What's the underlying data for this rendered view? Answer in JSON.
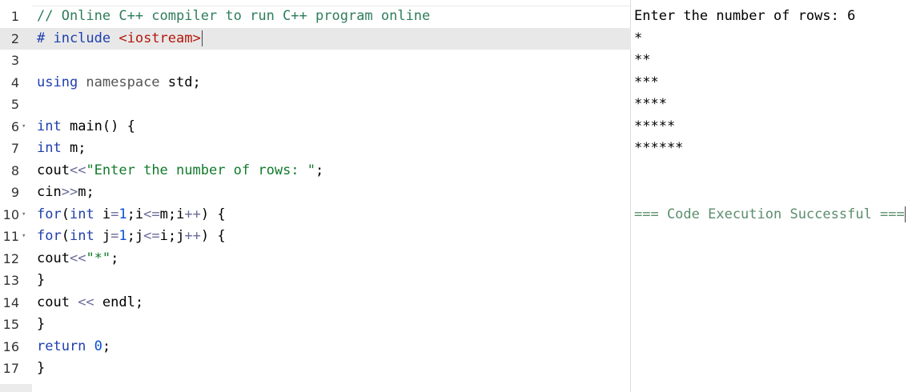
{
  "editor": {
    "lines": [
      {
        "n": "1",
        "parts": [
          {
            "t": "// Online C++ compiler to run C++ program online",
            "c": "cmt"
          }
        ]
      },
      {
        "n": "2",
        "active": true,
        "parts": [
          {
            "t": "# include ",
            "c": "kw"
          },
          {
            "t": "<iostream>",
            "c": "inc"
          }
        ]
      },
      {
        "n": "3",
        "parts": []
      },
      {
        "n": "4",
        "parts": [
          {
            "t": "using ",
            "c": "kw"
          },
          {
            "t": "namespace ",
            "c": "ns"
          },
          {
            "t": "std;",
            "c": ""
          }
        ]
      },
      {
        "n": "5",
        "parts": []
      },
      {
        "n": "6",
        "fold": true,
        "parts": [
          {
            "t": "int ",
            "c": "kw"
          },
          {
            "t": "main() {",
            "c": ""
          }
        ]
      },
      {
        "n": "7",
        "parts": [
          {
            "t": "int ",
            "c": "kw"
          },
          {
            "t": "m;",
            "c": ""
          }
        ]
      },
      {
        "n": "8",
        "parts": [
          {
            "t": "cout",
            "c": ""
          },
          {
            "t": "<<",
            "c": "op"
          },
          {
            "t": "\"Enter the number of rows: \"",
            "c": "str"
          },
          {
            "t": ";",
            "c": ""
          }
        ]
      },
      {
        "n": "9",
        "parts": [
          {
            "t": "cin",
            "c": ""
          },
          {
            "t": ">>",
            "c": "op"
          },
          {
            "t": "m;",
            "c": ""
          }
        ]
      },
      {
        "n": "10",
        "fold": true,
        "parts": [
          {
            "t": "for",
            "c": "kw"
          },
          {
            "t": "(",
            "c": ""
          },
          {
            "t": "int ",
            "c": "kw"
          },
          {
            "t": "i",
            "c": ""
          },
          {
            "t": "=",
            "c": "op"
          },
          {
            "t": "1",
            "c": "num"
          },
          {
            "t": ";i",
            "c": ""
          },
          {
            "t": "<=",
            "c": "op"
          },
          {
            "t": "m;i",
            "c": ""
          },
          {
            "t": "++",
            "c": "op"
          },
          {
            "t": ") {",
            "c": ""
          }
        ]
      },
      {
        "n": "11",
        "fold": true,
        "parts": [
          {
            "t": "for",
            "c": "kw"
          },
          {
            "t": "(",
            "c": ""
          },
          {
            "t": "int ",
            "c": "kw"
          },
          {
            "t": "j",
            "c": ""
          },
          {
            "t": "=",
            "c": "op"
          },
          {
            "t": "1",
            "c": "num"
          },
          {
            "t": ";j",
            "c": ""
          },
          {
            "t": "<=",
            "c": "op"
          },
          {
            "t": "i;j",
            "c": ""
          },
          {
            "t": "++",
            "c": "op"
          },
          {
            "t": ") {",
            "c": ""
          }
        ]
      },
      {
        "n": "12",
        "parts": [
          {
            "t": "cout",
            "c": ""
          },
          {
            "t": "<<",
            "c": "op"
          },
          {
            "t": "\"*\"",
            "c": "str"
          },
          {
            "t": ";",
            "c": ""
          }
        ]
      },
      {
        "n": "13",
        "parts": [
          {
            "t": "}",
            "c": ""
          }
        ]
      },
      {
        "n": "14",
        "parts": [
          {
            "t": "cout ",
            "c": ""
          },
          {
            "t": "<< ",
            "c": "op"
          },
          {
            "t": "endl;",
            "c": ""
          }
        ]
      },
      {
        "n": "15",
        "parts": [
          {
            "t": "}",
            "c": ""
          }
        ]
      },
      {
        "n": "16",
        "parts": [
          {
            "t": "return ",
            "c": "kw"
          },
          {
            "t": "0",
            "c": "num"
          },
          {
            "t": ";",
            "c": ""
          }
        ]
      },
      {
        "n": "17",
        "parts": [
          {
            "t": "}",
            "c": ""
          }
        ]
      }
    ]
  },
  "output": {
    "lines": [
      "Enter the number of rows: 6",
      "*",
      "**",
      "***",
      "****",
      "*****",
      "******",
      "",
      "",
      "=== Code Execution Successful ==="
    ]
  }
}
